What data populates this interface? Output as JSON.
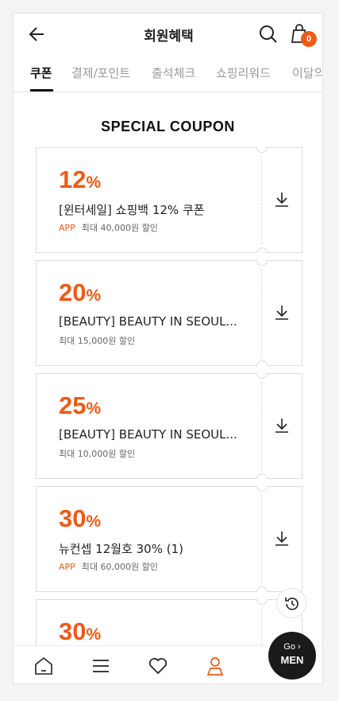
{
  "header": {
    "title": "회원혜택",
    "cart_count": "0"
  },
  "tabs": [
    {
      "label": "쿠폰"
    },
    {
      "label": "결제/포인트"
    },
    {
      "label": "출석체크"
    },
    {
      "label": "쇼핑리워드"
    },
    {
      "label": "이달의"
    }
  ],
  "section_title": "SPECIAL COUPON",
  "coupons": [
    {
      "percent": "12",
      "sign": "%",
      "name": "[윈터세일] 쇼핑백 12% 쿠폰",
      "app": "APP",
      "limit": "최대 40,000원 할인"
    },
    {
      "percent": "20",
      "sign": "%",
      "name": "[BEAUTY] BEAUTY IN SEOUL...",
      "app": "",
      "limit": "최대 15,000원 할인"
    },
    {
      "percent": "25",
      "sign": "%",
      "name": "[BEAUTY] BEAUTY IN SEOUL...",
      "app": "",
      "limit": "최대 10,000원 할인"
    },
    {
      "percent": "30",
      "sign": "%",
      "name": "뉴컨셉 12월호 30% (1)",
      "app": "APP",
      "limit": "최대 60,000원 할인"
    },
    {
      "percent": "30",
      "sign": "%",
      "name": "",
      "app": "",
      "limit": ""
    }
  ],
  "go_men": {
    "go": "Go ›",
    "men": "MEN"
  },
  "colors": {
    "accent": "#f05a14",
    "text": "#222222",
    "muted": "#999999"
  }
}
